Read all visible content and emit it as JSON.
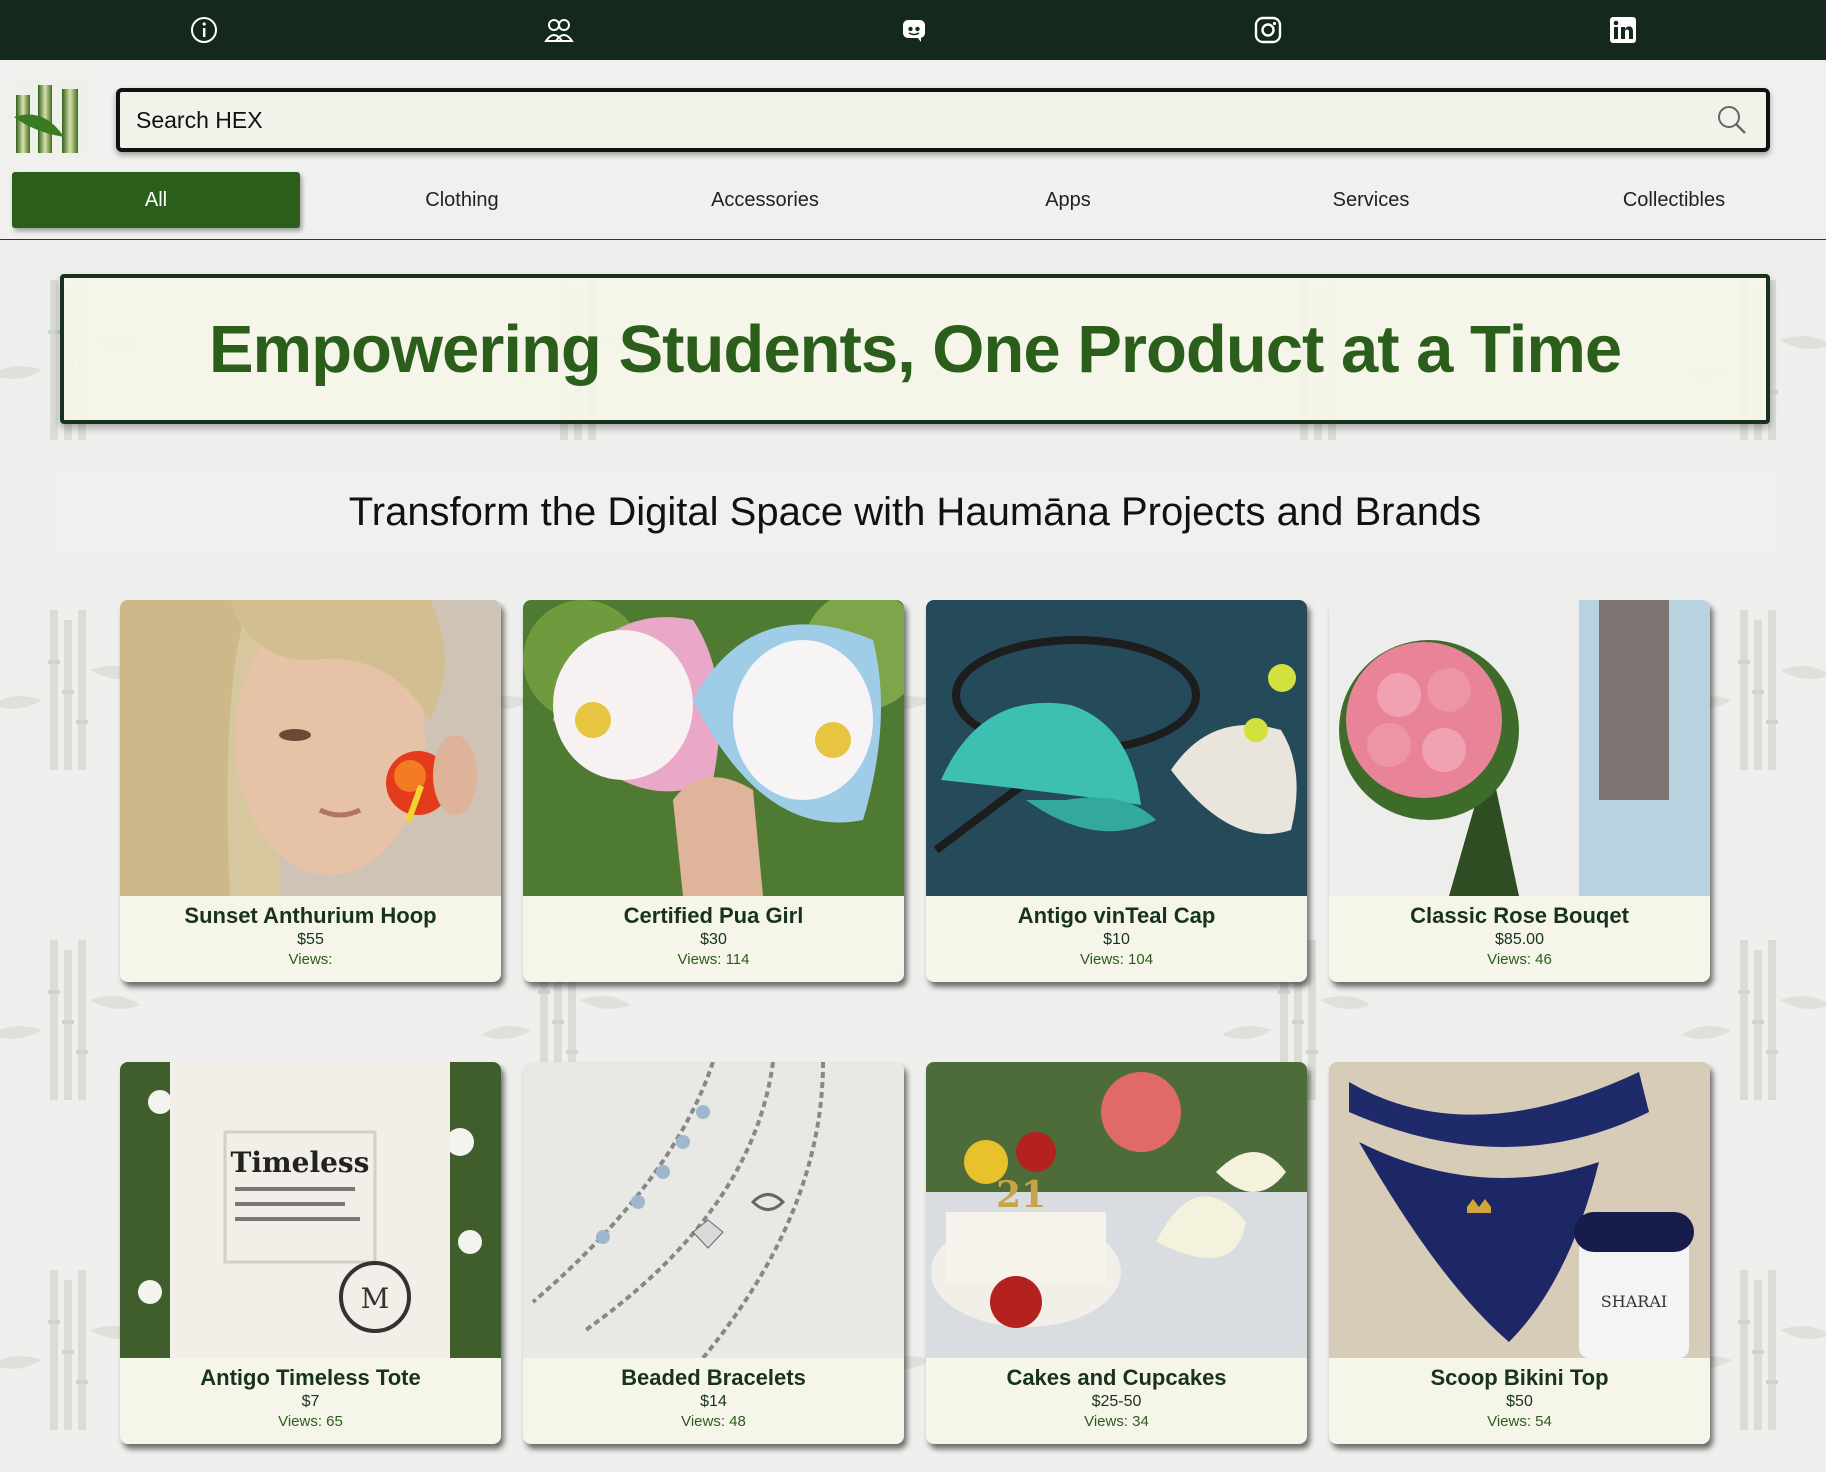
{
  "topbar": {
    "icons": [
      "info-icon",
      "community-icon",
      "discord-icon",
      "instagram-icon",
      "linkedin-icon"
    ]
  },
  "search": {
    "placeholder": "Search HEX"
  },
  "categories": [
    "All",
    "Clothing",
    "Accessories",
    "Apps",
    "Services",
    "Collectibles"
  ],
  "active_category": "All",
  "hero": {
    "title": "Empowering Students, One Product at a Time"
  },
  "subheading": "Transform the Digital Space with Haumāna Projects and Brands",
  "products": [
    {
      "name": "Sunset Anthurium Hoop",
      "price": "$55",
      "views": "Views: "
    },
    {
      "name": "Certified Pua Girl",
      "price": "$30",
      "views": "Views: 114"
    },
    {
      "name": "Antigo vinTeal Cap",
      "price": "$10",
      "views": "Views: 104"
    },
    {
      "name": "Classic Rose Bouqet",
      "price": "$85.00",
      "views": "Views: 46"
    },
    {
      "name": "Antigo Timeless Tote",
      "price": "$7",
      "views": "Views: 65"
    },
    {
      "name": "Beaded Bracelets",
      "price": "$14",
      "views": "Views: 48"
    },
    {
      "name": "Cakes and Cupcakes",
      "price": "$25-50",
      "views": "Views: 34"
    },
    {
      "name": "Scoop Bikini Top",
      "price": "$50",
      "views": "Views: 54"
    }
  ],
  "product_images": {
    "p1": "photo of woman wearing red anthurium hoop earring",
    "p2": "pink and blue trucker hats with flower patches",
    "p3": "teal and white caps with tennis racket",
    "p4": "bouquet of pink roses",
    "p5": "white canvas tote with Timeless print on grass",
    "p6": "silver beaded bracelets on white lace",
    "p7": "cake with flowers and bouquet",
    "p8": "navy bikini top on towel"
  },
  "product_image_text": {
    "tote": "Timeless",
    "cake": "21",
    "sharai": "SHARAI"
  },
  "colors": {
    "topbar": "#14291c",
    "accent": "#2b5e1a",
    "card_bg": "#f5f5ea"
  }
}
